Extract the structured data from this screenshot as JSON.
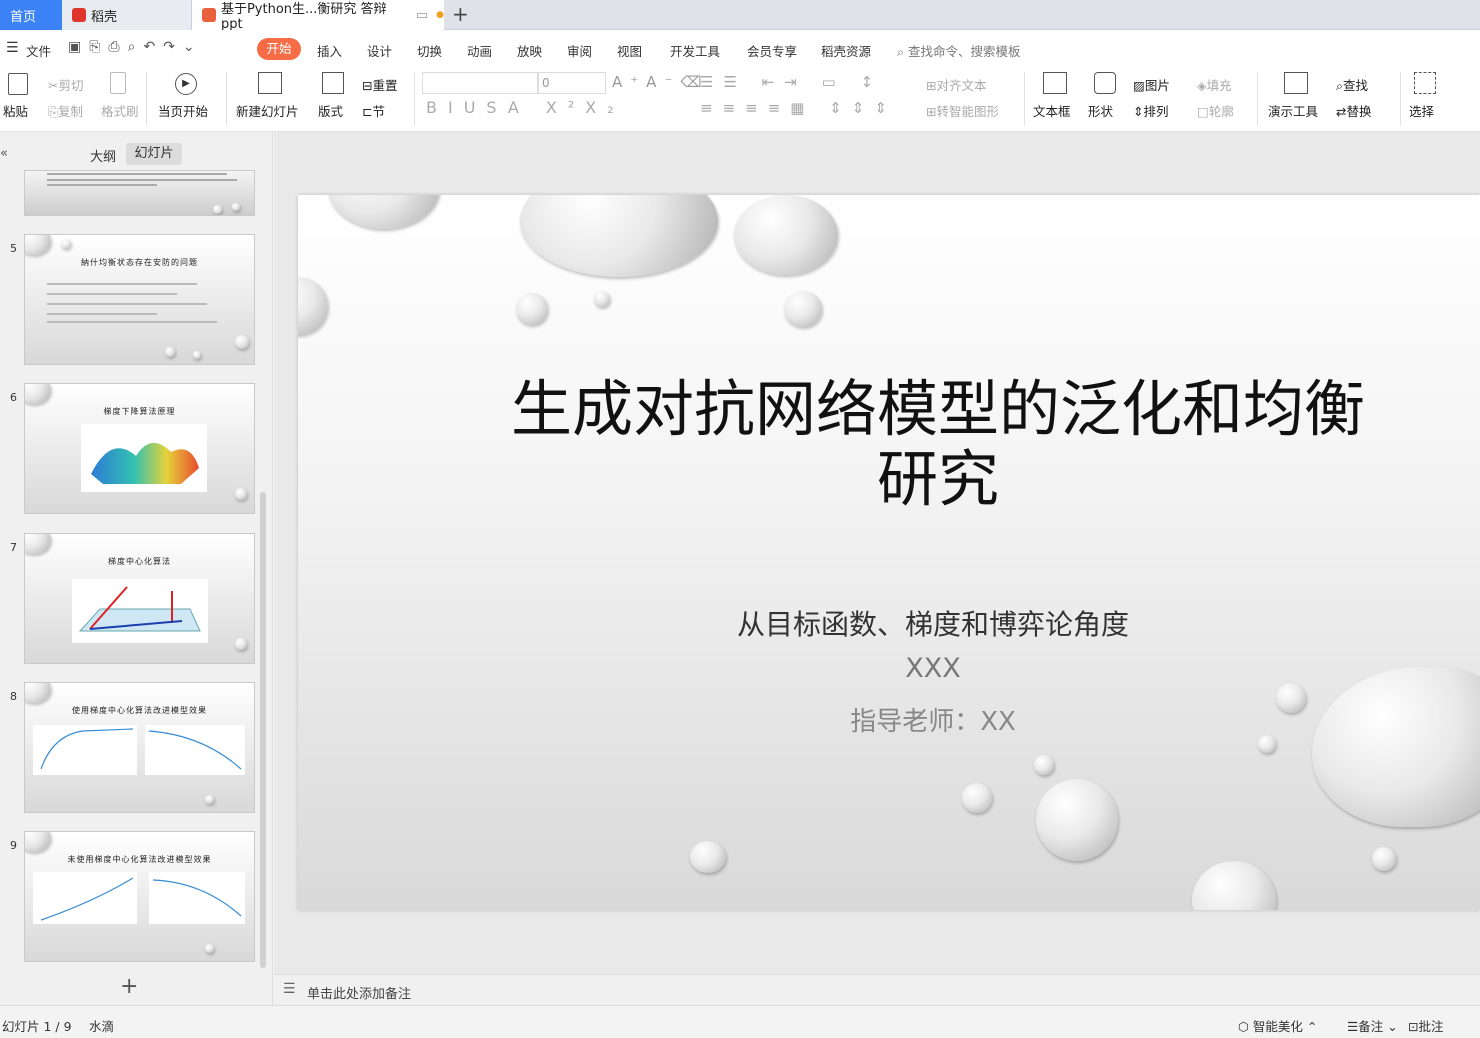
{
  "tabs": [
    {
      "label": "首页"
    },
    {
      "label": "稻壳"
    },
    {
      "label": "基于Python生...衡研究 答辩ppt"
    }
  ],
  "menubar": {
    "file": "文件",
    "tabs": [
      "开始",
      "插入",
      "设计",
      "切换",
      "动画",
      "放映",
      "审阅",
      "视图",
      "开发工具",
      "会员专享",
      "稻壳资源"
    ],
    "search_placeholder": "查找命令、搜索模板"
  },
  "toolbar": {
    "paste": "粘贴",
    "cut": "剪切",
    "copy": "复制",
    "format_painter": "格式刷",
    "play_current": "当页开始",
    "new_slide": "新建幻灯片",
    "layout": "版式",
    "reset": "重置",
    "section": "节",
    "font_size": "0",
    "align_text": "对齐文本",
    "smart_graphic": "转智能图形",
    "textbox": "文本框",
    "shape": "形状",
    "picture": "图片",
    "arrange": "排列",
    "fill": "填充",
    "outline": "轮廓",
    "present_tools": "演示工具",
    "find": "查找",
    "replace": "替换",
    "select": "选择"
  },
  "panel": {
    "outline_tab": "大纲",
    "slides_tab": "幻灯片",
    "thumbs": [
      {
        "num": "5",
        "title": "納什均衡状态存在安防的问题"
      },
      {
        "num": "6",
        "title": "梯度下降算法原理"
      },
      {
        "num": "7",
        "title": "梯度中心化算法"
      },
      {
        "num": "8",
        "title": "使用梯度中心化算法改进模型效果"
      },
      {
        "num": "9",
        "title": "未使用梯度中心化算法改进模型效果"
      }
    ]
  },
  "slide": {
    "title": "生成对抗网络模型的泛化和均衡研究",
    "subtitle": "从目标函数、梯度和博弈论角度",
    "author": "XXX",
    "advisor": "指导老师：XX"
  },
  "notes_placeholder": "单击此处添加备注",
  "status": {
    "slide_count": "幻灯片 1 / 9",
    "theme": "水滴",
    "beautify": "智能美化",
    "notes": "备注",
    "comments": "批注"
  },
  "colors": {
    "accent": "#3b82f6",
    "start_tab": "#f56c46"
  }
}
